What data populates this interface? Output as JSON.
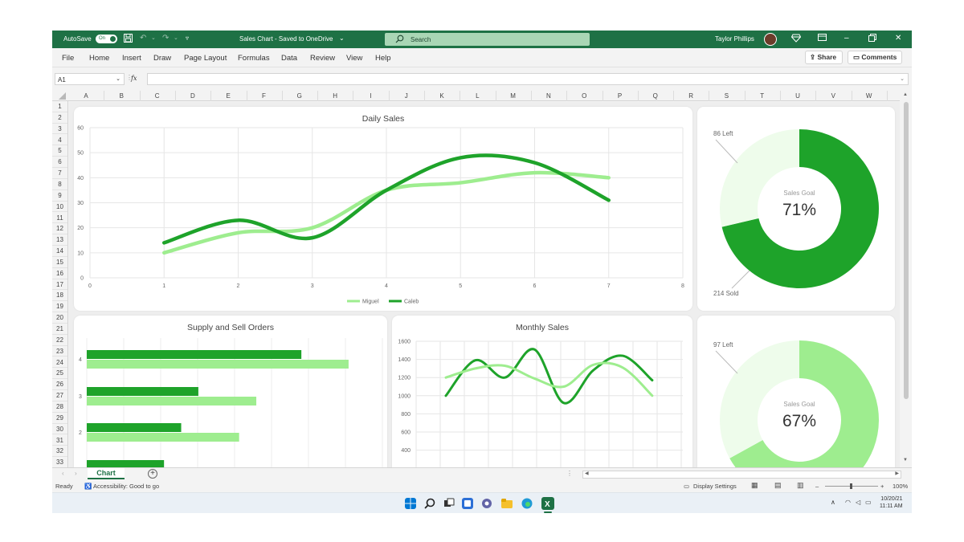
{
  "titlebar": {
    "autosave_label": "AutoSave",
    "autosave_state": "On",
    "document_title": "Sales Chart - Saved to OneDrive",
    "search_placeholder": "Search",
    "user_name": "Taylor Phillips"
  },
  "menu": [
    "File",
    "Home",
    "Insert",
    "Draw",
    "Page Layout",
    "Formulas",
    "Data",
    "Review",
    "View",
    "Help"
  ],
  "ribbon_actions": {
    "share": "Share",
    "comments": "Comments"
  },
  "formula_bar": {
    "name_box": "A1",
    "fx": "fx",
    "formula": ""
  },
  "columns": [
    "A",
    "B",
    "C",
    "D",
    "E",
    "F",
    "G",
    "H",
    "I",
    "J",
    "K",
    "L",
    "M",
    "N",
    "O",
    "P",
    "Q",
    "R",
    "S",
    "T",
    "U",
    "V",
    "W"
  ],
  "rows": [
    "1",
    "2",
    "3",
    "4",
    "5",
    "6",
    "7",
    "8",
    "9",
    "10",
    "11",
    "12",
    "13",
    "14",
    "15",
    "16",
    "17",
    "18",
    "19",
    "20",
    "21",
    "22",
    "23",
    "24",
    "25",
    "26",
    "27",
    "28",
    "29",
    "30",
    "31",
    "32",
    "33"
  ],
  "colors": {
    "title_bar": "#1e7145",
    "dark_green": "#1ea32a",
    "light_green": "#9eed8f",
    "pale_green": "#eefceb"
  },
  "charts": {
    "daily_sales": {
      "title": "Daily Sales",
      "y_ticks": [
        "0",
        "10",
        "20",
        "30",
        "40",
        "50",
        "60"
      ],
      "x_ticks": [
        "0",
        "1",
        "2",
        "3",
        "4",
        "5",
        "6",
        "7",
        "8"
      ],
      "legend": [
        "Miguel",
        "Caleb"
      ]
    },
    "supply_sell": {
      "title": "Supply and Sell Orders",
      "y_ticks": [
        "4",
        "3",
        "2"
      ]
    },
    "monthly_sales": {
      "title": "Monthly Sales",
      "y_ticks": [
        "1600",
        "1400",
        "1200",
        "1000",
        "800",
        "600",
        "400"
      ]
    },
    "donut_1": {
      "left_label": "86 Left",
      "sold_label": "214 Sold",
      "goal_label": "Sales Goal",
      "percent": "71%"
    },
    "donut_2": {
      "left_label": "97 Left",
      "goal_label": "Sales Goal",
      "percent": "67%"
    }
  },
  "chart_data": [
    {
      "type": "line",
      "title": "Daily Sales",
      "xlim": [
        0,
        8
      ],
      "ylim": [
        0,
        60
      ],
      "x": [
        1,
        2,
        3,
        4,
        5,
        6,
        7
      ],
      "series": [
        {
          "name": "Miguel",
          "values": [
            10,
            18,
            20,
            35,
            38,
            42,
            40
          ]
        },
        {
          "name": "Caleb",
          "values": [
            14,
            23,
            16,
            35,
            48,
            46,
            31
          ]
        }
      ]
    },
    {
      "type": "bar",
      "orientation": "horizontal",
      "title": "Supply and Sell Orders",
      "categories": [
        "4",
        "3",
        "2",
        "1"
      ],
      "series": [
        {
          "values": [
            100,
            52,
            44,
            36
          ]
        },
        {
          "values": [
            122,
            79,
            71,
            0
          ]
        }
      ]
    },
    {
      "type": "line",
      "title": "Monthly Sales",
      "ylim": [
        400,
        1600
      ],
      "x": [
        1,
        2,
        3,
        4,
        5,
        6,
        7,
        8
      ],
      "series": [
        {
          "values": [
            1000,
            1390,
            1200,
            1510,
            920,
            1280,
            1440,
            1170
          ]
        },
        {
          "values": [
            1200,
            1300,
            1330,
            1190,
            1100,
            1340,
            1310,
            1000
          ]
        }
      ]
    },
    {
      "type": "pie",
      "title": "",
      "categories": [
        "Sold",
        "Left"
      ],
      "values": [
        214,
        86
      ]
    },
    {
      "type": "pie",
      "title": "",
      "categories": [
        "Sold",
        "Left"
      ],
      "values": [
        67,
        33
      ]
    }
  ],
  "sheet_tabs": [
    "Chart"
  ],
  "status": {
    "ready": "Ready",
    "accessibility": "Accessibility: Good to go",
    "display_settings": "Display Settings",
    "zoom": "100%"
  },
  "taskbar": {
    "time": "11:11 AM",
    "date": "10/20/21"
  }
}
